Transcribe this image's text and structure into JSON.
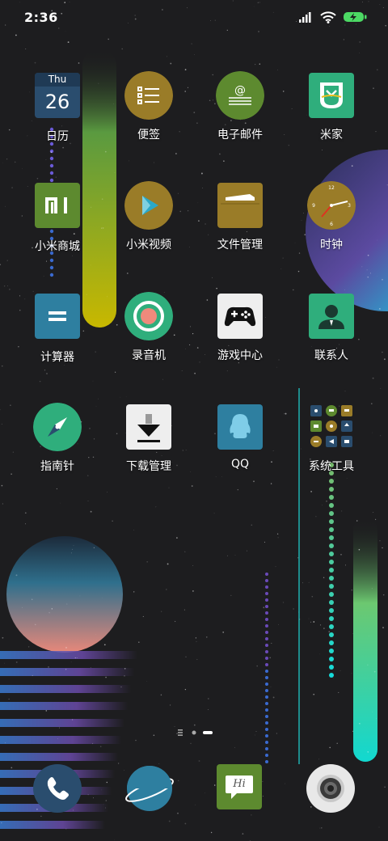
{
  "status_bar": {
    "time": "2:36"
  },
  "calendar": {
    "weekday": "Thu",
    "day": "26"
  },
  "apps": [
    {
      "label": "日历"
    },
    {
      "label": "便签"
    },
    {
      "label": "电子邮件"
    },
    {
      "label": "米家"
    },
    {
      "label": "小米商城"
    },
    {
      "label": "小米视频"
    },
    {
      "label": "文件管理"
    },
    {
      "label": "时钟"
    },
    {
      "label": "计算器"
    },
    {
      "label": "录音机"
    },
    {
      "label": "游戏中心"
    },
    {
      "label": "联系人"
    },
    {
      "label": "指南针"
    },
    {
      "label": "下载管理"
    },
    {
      "label": "QQ"
    },
    {
      "label": "系统工具"
    }
  ],
  "pager": {
    "pages": 3,
    "current": 3
  },
  "messaging": {
    "bubble_text": "Hi"
  }
}
